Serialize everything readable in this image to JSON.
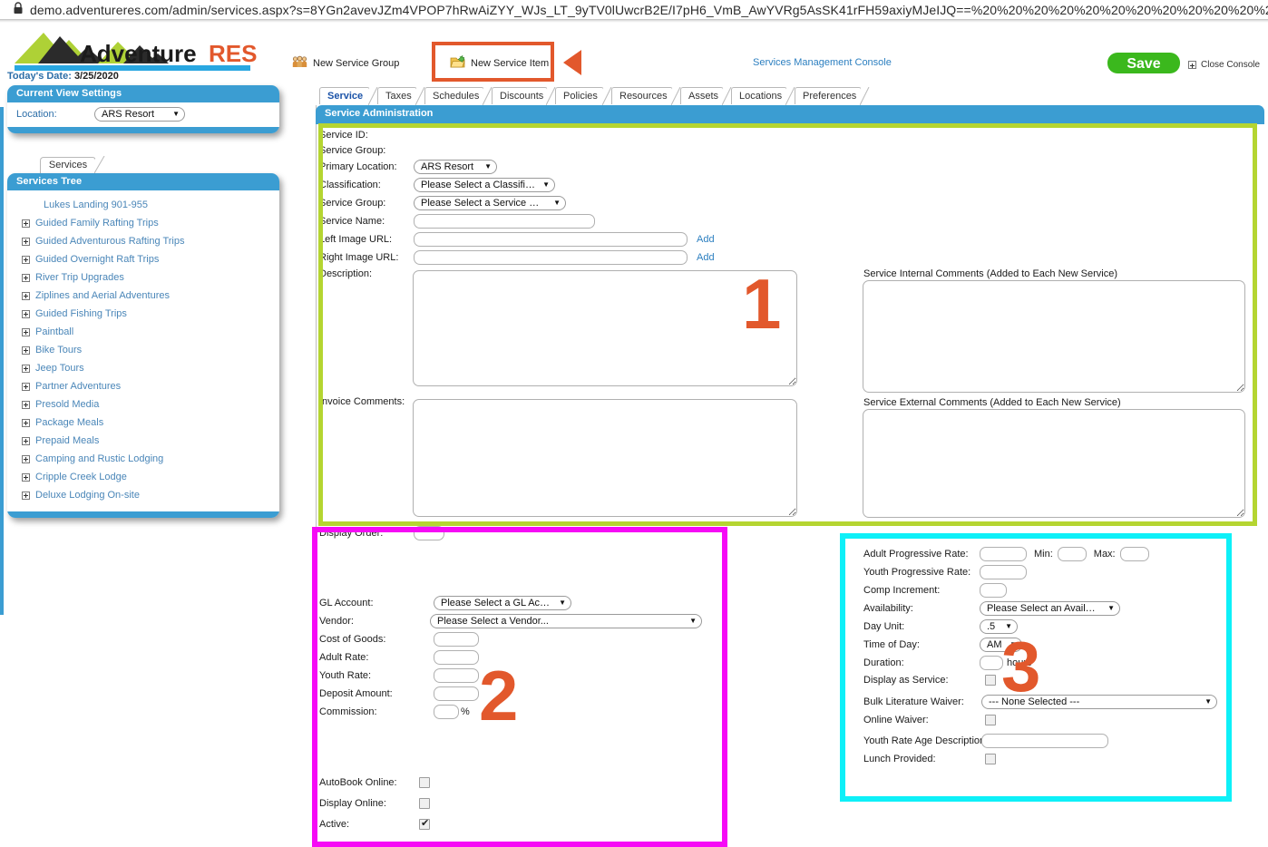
{
  "browser": {
    "url": "demo.adventureres.com/admin/services.aspx?s=8YGn2avevJZm4VPOP7hRwAiZYY_WJs_LT_9yTV0lUwcrB2E/I7pH6_VmB_AwYVRg5AsSK41rFH59axiyMJeIJQ==%20%20%20%20%20%20%20%20%20%20%20%20%20%20%20%20%20%20%20%20%20",
    "lock_icon": "lock-icon"
  },
  "header": {
    "logo_text_1": "Adventure",
    "logo_text_2": "RES",
    "new_service_group": "New Service Group",
    "new_service_item": "New Service Item",
    "services_management_console": "Services Management Console",
    "save_label": "Save",
    "close_console": "Close Console"
  },
  "sidebar": {
    "todays_date_label": "Today's Date:",
    "todays_date_value": "3/25/2020",
    "view_settings_title": "Current View Settings",
    "location_label": "Location:",
    "location_value": "ARS Resort",
    "services_tab": "Services",
    "tree_title": "Services Tree",
    "tree_items": [
      {
        "label": "Lukes Landing 901-955",
        "expandable": false
      },
      {
        "label": "Guided Family Rafting Trips",
        "expandable": true
      },
      {
        "label": "Guided Adventurous Rafting Trips",
        "expandable": true
      },
      {
        "label": "Guided Overnight Raft Trips",
        "expandable": true
      },
      {
        "label": "River Trip Upgrades",
        "expandable": true
      },
      {
        "label": "Ziplines and Aerial Adventures",
        "expandable": true
      },
      {
        "label": "Guided Fishing Trips",
        "expandable": true
      },
      {
        "label": "Paintball",
        "expandable": true
      },
      {
        "label": "Bike Tours",
        "expandable": true
      },
      {
        "label": "Jeep Tours",
        "expandable": true
      },
      {
        "label": "Partner Adventures",
        "expandable": true
      },
      {
        "label": "Presold Media",
        "expandable": true
      },
      {
        "label": "Package Meals",
        "expandable": true
      },
      {
        "label": "Prepaid Meals",
        "expandable": true
      },
      {
        "label": "Camping and Rustic Lodging",
        "expandable": true
      },
      {
        "label": "Cripple Creek Lodge",
        "expandable": true
      },
      {
        "label": "Deluxe Lodging On-site",
        "expandable": true
      }
    ]
  },
  "tabs": [
    {
      "label": "Service",
      "active": true
    },
    {
      "label": "Taxes",
      "active": false
    },
    {
      "label": "Schedules",
      "active": false
    },
    {
      "label": "Discounts",
      "active": false
    },
    {
      "label": "Policies",
      "active": false
    },
    {
      "label": "Resources",
      "active": false
    },
    {
      "label": "Assets",
      "active": false
    },
    {
      "label": "Locations",
      "active": false
    },
    {
      "label": "Preferences",
      "active": false
    }
  ],
  "form": {
    "panel_title": "Service Administration",
    "service_id_label": "Service ID:",
    "service_id_value": "",
    "service_group_top_label": "Service Group:",
    "service_group_top_value": "",
    "primary_location_label": "Primary Location:",
    "primary_location_value": "ARS Resort",
    "classification_label": "Classification:",
    "classification_value": "Please Select a Classification...",
    "service_group_label": "Service Group:",
    "service_group_value": "Please Select a Service Group...",
    "service_name_label": "Service Name:",
    "service_name_value": "",
    "left_image_url_label": "Left Image URL:",
    "left_image_url_value": "",
    "left_image_add": "Add",
    "right_image_url_label": "Right Image URL:",
    "right_image_url_value": "",
    "right_image_add": "Add",
    "description_label": "Description:",
    "description_value": "",
    "invoice_comments_label": "Invoice Comments:",
    "invoice_comments_value": "",
    "internal_comments_label": "Service Internal Comments (Added to Each New Service)",
    "internal_comments_value": "",
    "external_comments_label": "Service External Comments (Added to Each New Service)",
    "external_comments_value": "",
    "display_order_label": "Display Order:",
    "display_order_value": ""
  },
  "financial": {
    "gl_account_label": "GL Account:",
    "gl_account_value": "Please Select a GL Account...",
    "vendor_label": "Vendor:",
    "vendor_value": "Please Select a Vendor...",
    "cost_of_goods_label": "Cost of Goods:",
    "cost_of_goods_value": "",
    "adult_rate_label": "Adult Rate:",
    "adult_rate_value": "",
    "youth_rate_label": "Youth Rate:",
    "youth_rate_value": "",
    "deposit_amount_label": "Deposit Amount:",
    "deposit_amount_value": "",
    "commission_label": "Commission:",
    "commission_value": "",
    "commission_suffix": "%",
    "autobook_online_label": "AutoBook Online:",
    "autobook_online_checked": false,
    "display_online_label": "Display Online:",
    "display_online_checked": false,
    "active_label": "Active:",
    "active_checked": true
  },
  "scheduling": {
    "adult_progressive_rate_label": "Adult Progressive Rate:",
    "adult_progressive_rate_value": "",
    "min_label": "Min:",
    "min_value": "",
    "max_label": "Max:",
    "max_value": "",
    "youth_progressive_rate_label": "Youth Progressive Rate:",
    "youth_progressive_rate_value": "",
    "comp_increment_label": "Comp Increment:",
    "comp_increment_value": "",
    "availability_label": "Availability:",
    "availability_value": "Please Select an Availability...",
    "day_unit_label": "Day Unit:",
    "day_unit_value": ".5",
    "time_of_day_label": "Time of Day:",
    "time_of_day_value": "AM",
    "duration_label": "Duration:",
    "duration_value": "",
    "duration_suffix": "hours",
    "display_as_service_label": "Display as Service:",
    "display_as_service_checked": false,
    "bulk_literature_waiver_label": "Bulk Literature Waiver:",
    "bulk_literature_waiver_value": "--- None Selected ---",
    "online_waiver_label": "Online Waiver:",
    "online_waiver_checked": false,
    "youth_rate_age_description_label": "Youth Rate Age Description:",
    "youth_rate_age_description_value": "",
    "lunch_provided_label": "Lunch Provided:",
    "lunch_provided_checked": false
  },
  "annotations": {
    "box1_number": "1",
    "box1_color": "#b5d531",
    "box2_number": "2",
    "box2_color": "#f60af6",
    "box3_number": "3",
    "box3_color": "#0ef0f8",
    "highlight_color": "#e2582c"
  }
}
